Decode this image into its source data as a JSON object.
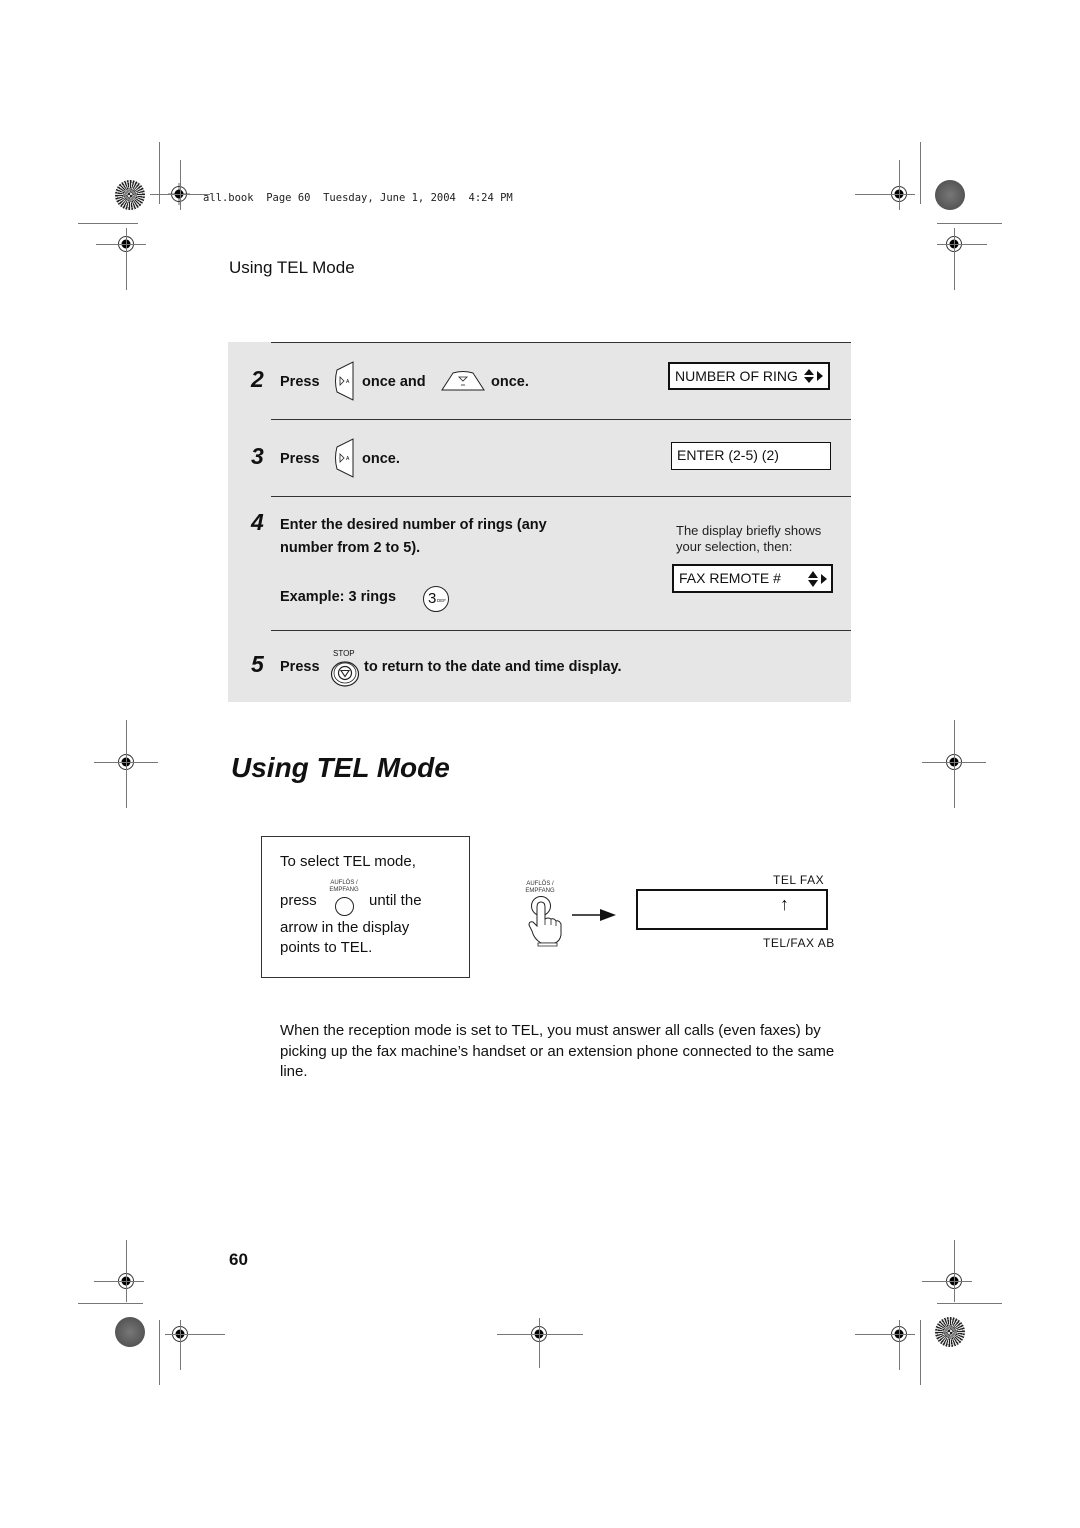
{
  "header": {
    "print_info": "all.book  Page 60  Tuesday, June 1, 2004  4:24 PM"
  },
  "running_title": "Using TEL Mode",
  "steps_panel": {
    "steps": [
      {
        "number": "2",
        "parts": [
          "Press",
          "once and",
          "once."
        ],
        "icons": [
          "right-arrow-key-icon",
          "down-arrow-key-icon"
        ],
        "display": "NUMBER OF RING"
      },
      {
        "number": "3",
        "parts": [
          "Press",
          "once."
        ],
        "icons": [
          "right-arrow-key-icon"
        ],
        "display": "ENTER (2-5) (2)"
      },
      {
        "number": "4",
        "line1": "Enter the desired number of rings (any",
        "line2": "number from 2 to 5).",
        "example": "Example: 3 rings",
        "key_label": "3",
        "key_sub": "DEF",
        "note_line1": "The display briefly shows",
        "note_line2": "your selection, then:",
        "display": "FAX REMOTE #"
      },
      {
        "number": "5",
        "press": "Press",
        "key_label": "STOP",
        "rest": "to return to the date and time display."
      }
    ]
  },
  "section": {
    "title": "Using TEL Mode",
    "instruction_box": {
      "line1": "To select TEL mode,",
      "press": "press",
      "key_label_1": "AUFLÖS /",
      "key_label_2": "EMPFANG",
      "until": "until the",
      "line3": "arrow in the display",
      "line4": "points to TEL."
    },
    "illustration": {
      "key_label_1": "AUFLÖS /",
      "key_label_2": "EMPFANG",
      "top_labels": "TEL  FAX",
      "bottom_labels": "TEL/FAX  AB",
      "arrow_glyph": "↑"
    },
    "paragraph": "When the reception mode is set to TEL, you must answer all calls (even faxes) by picking up the fax machine’s handset or an extension phone connected to the same line."
  },
  "page_number": "60"
}
